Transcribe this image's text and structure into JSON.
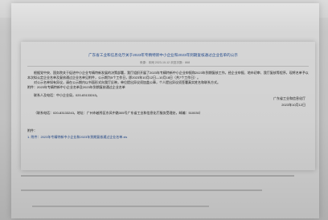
{
  "document": {
    "title": "广东省工业和信息化厅关于2023年专精特新中小企业和2023年到期复核通过企业名单的公示",
    "meta": "来源：本网  2023-10-12  浏览次数：868",
    "para1": "根据党中央、国务院关于促进中小企业专精特新发展的决策部署，我厅组织开展了2023年专精特新中小企业申报和2023年到期复核工作，经企业申报、地市初审、我厅复核等程序，现将名单予以公示。",
    "para2": "本次拟认定企业名单及复核通过企业名单见附件，公示期为5个工作日，即2023年10月12日—10月18日（共7个工作日）。",
    "para3": "对公示名单如有异议，请在公示期内以书面形式向我厅反映，单位提出异议须加盖公章，个人提出异议须签署真实姓名和联系方式。",
    "para4": "附件：2023年专精特新中小企业名单及2023年到期复核通过企业名单",
    "para5": "联系人及电话：中小企业局，020-83133243。",
    "signature_org": "广东省工业和信息化厅",
    "signature_date": "2023年10月12日",
    "contact": "（联系电话：020-83133243，地址：广州市越秀区东风中路305号广东省工业和信息化厅服务受理处，邮编：510030）",
    "attach_label": "附件：",
    "attach_link": "1. 附件：2023年专精特新中小企业和2023年到期复核通过企业名单.xls"
  }
}
